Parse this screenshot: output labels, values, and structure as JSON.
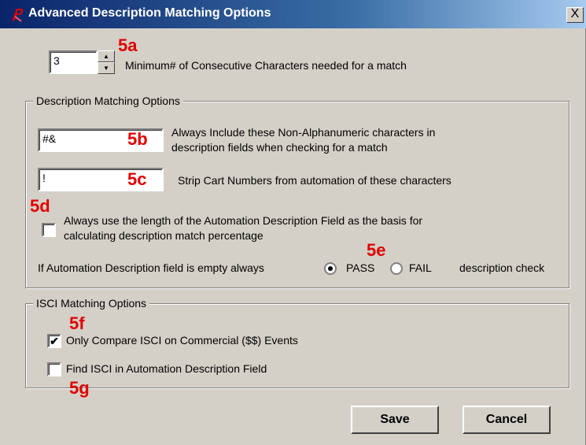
{
  "window": {
    "title": "Advanced Description Matching Options",
    "close_label": "X"
  },
  "min_chars": {
    "value": "3",
    "label": "Minimum# of Consecutive Characters needed for a match"
  },
  "description_group": {
    "legend": "Description Matching Options",
    "nonalpha": {
      "value": "#&",
      "label_line1": "Always Include these Non-Alphanumeric characters in",
      "label_line2": "description fields when checking for a match"
    },
    "strip": {
      "value": "!",
      "label": "Strip Cart Numbers from automation of these characters"
    },
    "use_length": {
      "checked": false,
      "label_line1": "Always use the length of the Automation Description Field as the basis for",
      "label_line2": "calculating description match percentage"
    },
    "empty_field": {
      "prefix": "If Automation Description field is empty always",
      "pass_label": "PASS",
      "fail_label": "FAIL",
      "suffix": "description check",
      "selected": "PASS"
    }
  },
  "isci_group": {
    "legend": "ISCI Matching Options",
    "only_commercial": {
      "checked": true,
      "label": "Only Compare ISCI on Commercial ($$) Events"
    },
    "find_isci": {
      "checked": false,
      "label": "Find ISCI in Automation Description Field"
    }
  },
  "buttons": {
    "save": "Save",
    "cancel": "Cancel"
  },
  "annotations": {
    "a": "5a",
    "b": "5b",
    "c": "5c",
    "d": "5d",
    "e": "5e",
    "f": "5f",
    "g": "5g"
  },
  "colors": {
    "annotation": "#e00000",
    "titlebar_start": "#0a246a",
    "titlebar_end": "#a6caf0",
    "dialog_bg": "#d4d0c8"
  }
}
